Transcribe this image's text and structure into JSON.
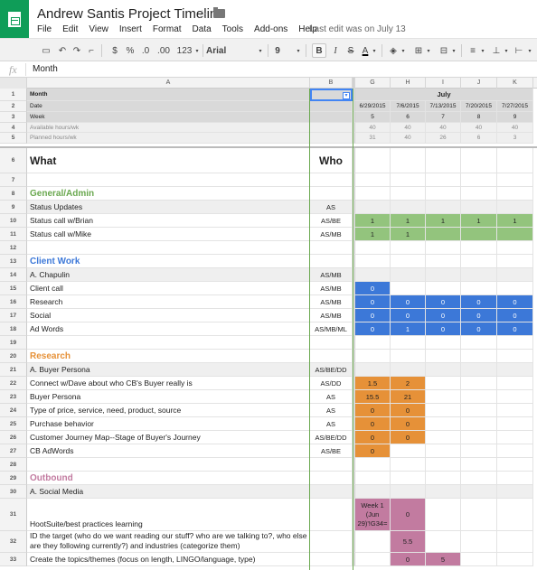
{
  "app": {
    "title": "Andrew Santis Project Timeline",
    "menu": [
      "File",
      "Edit",
      "View",
      "Insert",
      "Format",
      "Data",
      "Tools",
      "Add-ons",
      "Help"
    ],
    "last_edit": "Last edit was on July 13"
  },
  "toolbar": {
    "currency": "$",
    "percent": "%",
    "dec_decrease": ".0",
    "dec_increase": ".00",
    "number_format": "123",
    "font": "Arial",
    "font_size": "9",
    "bold": "B",
    "italic": "I",
    "strike": "S",
    "text_color": "A"
  },
  "formula_bar": {
    "fx": "fx",
    "value": "Month"
  },
  "columns": [
    "A",
    "B",
    "G",
    "H",
    "I",
    "J",
    "K"
  ],
  "header": {
    "month_label": "Month",
    "july": "July",
    "date_label": "Date",
    "week_label": "Week",
    "avail_label": "Available hours/wk",
    "planned_label": "Planned hours/wk",
    "dates": [
      "6/29/2015",
      "7/6/2015",
      "7/13/2015",
      "7/20/2015",
      "7/27/2015"
    ],
    "weeks": [
      "5",
      "6",
      "7",
      "8",
      "9"
    ],
    "available": [
      "40",
      "40",
      "40",
      "40",
      "40"
    ],
    "planned": [
      "31",
      "40",
      "26",
      "6",
      "3"
    ]
  },
  "what_label": "What",
  "who_label": "Who",
  "rows": [
    {
      "n": "7",
      "a": "",
      "b": ""
    },
    {
      "n": "8",
      "a": "General/Admin",
      "b": "",
      "style": "section-green"
    },
    {
      "n": "9",
      "a": "Status Updates",
      "b": "AS",
      "gray": true
    },
    {
      "n": "10",
      "a": "Status call w/Brian",
      "b": "AS/BE",
      "vals": [
        "1",
        "1",
        "1",
        "1",
        "1"
      ],
      "color": "green"
    },
    {
      "n": "11",
      "a": "Status call w/Mike",
      "b": "AS/MB",
      "vals": [
        "1",
        "1",
        "",
        "",
        ""
      ],
      "color": "green"
    },
    {
      "n": "12",
      "a": "",
      "b": ""
    },
    {
      "n": "13",
      "a": "Client Work",
      "b": "",
      "style": "section-blue"
    },
    {
      "n": "14",
      "a": "A. Chapulin",
      "b": "AS/MB",
      "gray": true
    },
    {
      "n": "15",
      "a": "Client call",
      "b": "AS/MB",
      "vals": [
        "0"
      ],
      "color": "blue",
      "span": 1
    },
    {
      "n": "16",
      "a": "Research",
      "b": "AS/MB",
      "vals": [
        "0",
        "0",
        "0",
        "0",
        "0"
      ],
      "color": "blue"
    },
    {
      "n": "17",
      "a": "Social",
      "b": "AS/MB",
      "vals": [
        "0",
        "0",
        "0",
        "0",
        "0"
      ],
      "color": "blue"
    },
    {
      "n": "18",
      "a": "Ad Words",
      "b": "AS/MB/ML",
      "vals": [
        "0",
        "1",
        "0",
        "0",
        "0"
      ],
      "color": "blue"
    },
    {
      "n": "19",
      "a": "",
      "b": ""
    },
    {
      "n": "20",
      "a": "Research",
      "b": "",
      "style": "section-orange"
    },
    {
      "n": "21",
      "a": "A. Buyer Persona",
      "b": "AS/BE/DD",
      "gray": true
    },
    {
      "n": "22",
      "a": "Connect w/Dave about who CB's Buyer really is",
      "b": "AS/DD",
      "vals": [
        "1.5",
        "2"
      ],
      "color": "orange",
      "span": 2
    },
    {
      "n": "23",
      "a": "Buyer Persona",
      "b": "AS",
      "vals": [
        "15.5",
        "21"
      ],
      "color": "orange",
      "span": 2
    },
    {
      "n": "24",
      "a": "Type of price, service, need, product, source",
      "b": "AS",
      "vals": [
        "0",
        "0"
      ],
      "color": "orange",
      "span": 2
    },
    {
      "n": "25",
      "a": "Purchase behavior",
      "b": "AS",
      "vals": [
        "0",
        "0"
      ],
      "color": "orange",
      "span": 2
    },
    {
      "n": "26",
      "a": "Customer Journey Map--Stage of Buyer's Journey",
      "b": "AS/BE/DD",
      "vals": [
        "0",
        "0"
      ],
      "color": "orange",
      "span": 2
    },
    {
      "n": "27",
      "a": "CB AdWords",
      "b": "AS/BE",
      "vals": [
        "0"
      ],
      "color": "orange",
      "span": 1
    },
    {
      "n": "28",
      "a": "",
      "b": ""
    },
    {
      "n": "29",
      "a": "Outbound",
      "b": "",
      "style": "section-pink"
    },
    {
      "n": "30",
      "a": "A. Social Media",
      "b": "",
      "gray": true
    },
    {
      "n": "31",
      "a": "HootSuite/best practices learning",
      "b": "",
      "g": "Week 1 (Jun 29)'!G34=",
      "h": "0"
    },
    {
      "n": "32",
      "a": "ID the target (who do we want reading our stuff? who are we talking to?, who else are they following currently?) and industries (categorize them)",
      "b": "",
      "h": "5.5"
    },
    {
      "n": "33",
      "a": "Create the topics/themes (focus on length, LINGO/language, type)",
      "b": "",
      "h": "0",
      "i": "5"
    }
  ]
}
